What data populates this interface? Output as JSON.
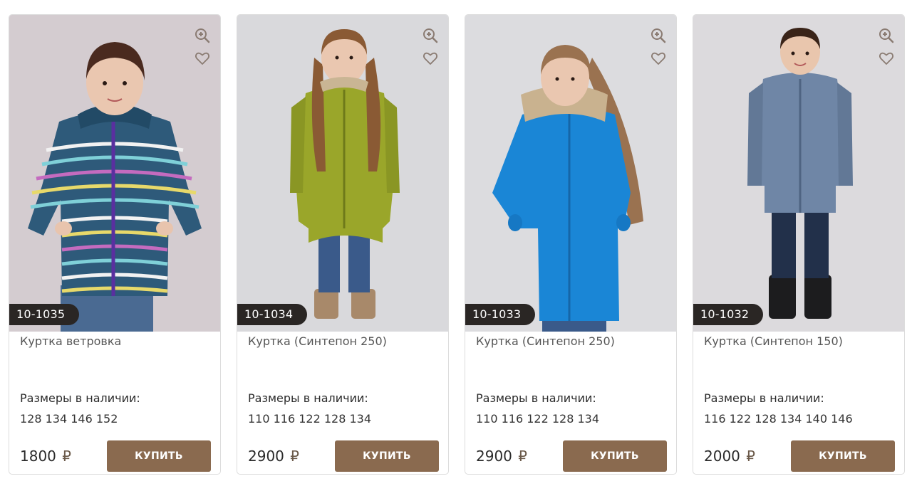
{
  "products": [
    {
      "sku": "10-1035",
      "name": "Куртка ветровка",
      "sizes_label": "Размеры в наличии:",
      "sizes": "128 134 146 152",
      "price": "1800",
      "currency": "₽",
      "buy_label": "КУПИТЬ",
      "zoom_icon": "zoom-in-icon",
      "favorite_icon": "heart-icon",
      "image": "girl in striped multicolor windbreaker jacket",
      "colors": {
        "background": "#d4ccd0",
        "garment": "#2e5a7a",
        "accent": "#e7d96a"
      }
    },
    {
      "sku": "10-1034",
      "name": "Куртка (Синтепон 250)",
      "sizes_label": "Размеры в наличии:",
      "sizes": "110 116 122 128 134",
      "price": "2900",
      "currency": "₽",
      "buy_label": "КУПИТЬ",
      "zoom_icon": "zoom-in-icon",
      "favorite_icon": "heart-icon",
      "image": "girl in olive green parka",
      "colors": {
        "background": "#d9d9dc",
        "garment": "#9aa62a",
        "accent": "#3a5a8a"
      }
    },
    {
      "sku": "10-1033",
      "name": "Куртка (Синтепон 250)",
      "sizes_label": "Размеры в наличии:",
      "sizes": "110 116 122 128 134",
      "price": "2900",
      "currency": "₽",
      "buy_label": "КУПИТЬ",
      "zoom_icon": "zoom-in-icon",
      "favorite_icon": "heart-icon",
      "image": "girl in bright blue parka with fur hood",
      "colors": {
        "background": "#dcdcdf",
        "garment": "#1a86d6",
        "accent": "#3a5a8a"
      }
    },
    {
      "sku": "10-1032",
      "name": "Куртка (Синтепон 150)",
      "sizes_label": "Размеры в наличии:",
      "sizes": "116 122 128 134 140 146",
      "price": "2000",
      "currency": "₽",
      "buy_label": "КУПИТЬ",
      "zoom_icon": "zoom-in-icon",
      "favorite_icon": "heart-icon",
      "image": "boy in grey-blue jacket",
      "colors": {
        "background": "#dcdadd",
        "garment": "#6f86a6",
        "accent": "#22304a"
      }
    }
  ],
  "theme": {
    "button": "#8a6a4f",
    "sku_badge": "#2a2624",
    "icon": "#8a7b72"
  }
}
